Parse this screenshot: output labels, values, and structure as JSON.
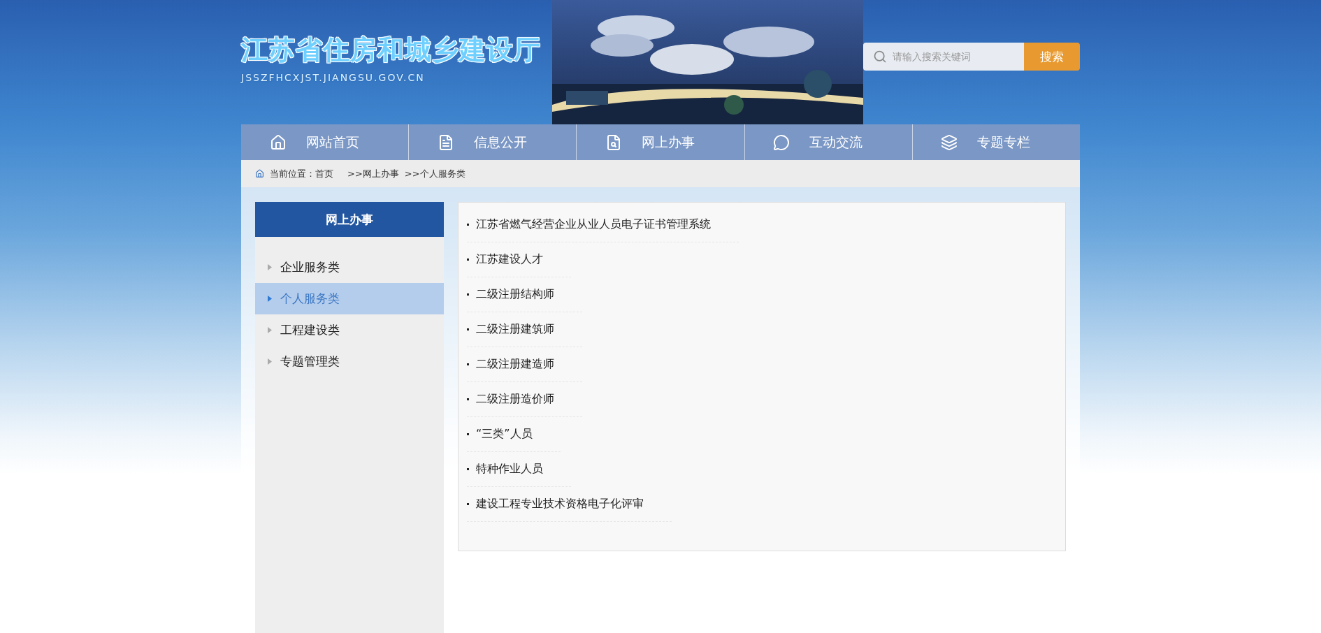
{
  "site": {
    "title": "江苏省住房和城乡建设厅",
    "domain": "JSSZFHCXJST.JIANGSU.GOV.CN"
  },
  "search": {
    "placeholder": "请输入搜索关键词",
    "button": "搜索"
  },
  "nav": [
    {
      "label": "网站首页"
    },
    {
      "label": "信息公开"
    },
    {
      "label": "网上办事"
    },
    {
      "label": "互动交流"
    },
    {
      "label": "专题专栏"
    }
  ],
  "breadcrumb": [
    "当前位置：首页",
    ">>网上办事",
    ">>个人服务类"
  ],
  "sidebar": {
    "title": "网上办事",
    "items": [
      {
        "label": "企业服务类",
        "selected": false
      },
      {
        "label": "个人服务类",
        "selected": true
      },
      {
        "label": "工程建设类",
        "selected": false
      },
      {
        "label": "专题管理类",
        "selected": false
      }
    ]
  },
  "list": [
    "江苏省燃气经营企业从业人员电子证书管理系统",
    "江苏建设人才",
    "二级注册结构师",
    "二级注册建筑师",
    "二级注册建造师",
    "二级注册造价师",
    "“三类”人员",
    "特种作业人员",
    "建设工程专业技术资格电子化评审"
  ]
}
